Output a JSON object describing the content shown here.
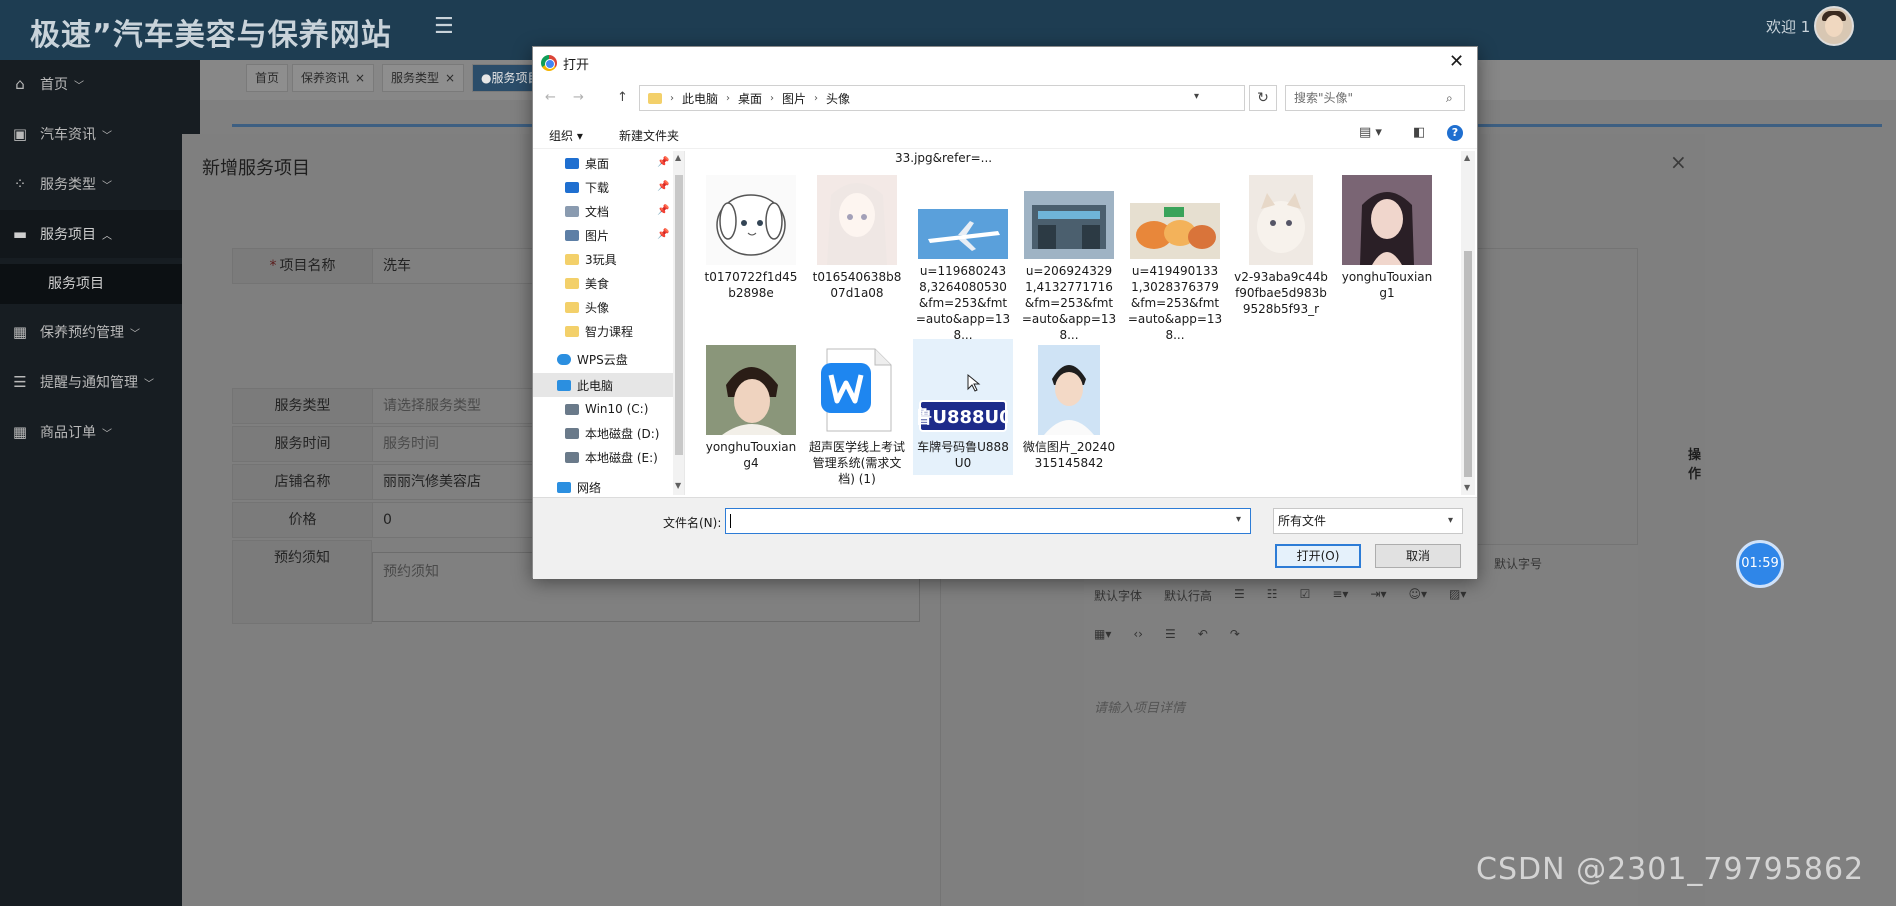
{
  "header": {
    "site_title": "极速”汽车美容与保养网站",
    "welcome": "欢迎 1"
  },
  "sidebar": {
    "items": [
      {
        "label": "首页",
        "icon": "home-icon"
      },
      {
        "label": "汽车资讯",
        "icon": "news-icon"
      },
      {
        "label": "服务类型",
        "icon": "grid-icon"
      },
      {
        "label": "服务项目",
        "icon": "folder-icon"
      },
      {
        "label": "保养预约管理",
        "icon": "table-icon"
      },
      {
        "label": "提醒与通知管理",
        "icon": "server-icon"
      },
      {
        "label": "商品订单",
        "icon": "table-icon"
      }
    ],
    "sub_item": "服务项目"
  },
  "tabs": [
    {
      "label": "首页"
    },
    {
      "label": "保养资讯"
    },
    {
      "label": "服务类型"
    },
    {
      "label": "●服务项目"
    }
  ],
  "modal": {
    "title": "新增服务项目",
    "close": "×",
    "fields": {
      "name_label": "项目名称",
      "name_required": "*",
      "name_value": "洗车",
      "type_label": "服务类型",
      "type_placeholder": "请选择服务类型",
      "time_label": "服务时间",
      "time_placeholder": "服务时间",
      "shop_label": "店铺名称",
      "shop_value": "丽丽汽修美容店",
      "price_label": "价格",
      "price_value": "0",
      "notice_label": "预约须知",
      "notice_placeholder": "预约须知"
    },
    "editor": {
      "font_size": "默认字号",
      "font_family": "默认字体",
      "line_height": "默认行高",
      "placeholder": "请输入项目详情"
    },
    "cut_label": "操作"
  },
  "timer": "01:59",
  "watermark": "CSDN @2301_79795862",
  "dialog": {
    "title": "打开",
    "breadcrumb": [
      "此电脑",
      "桌面",
      "图片",
      "头像"
    ],
    "search_placeholder": "搜索\"头像\"",
    "toolbar": {
      "organize": "组织 ▾",
      "new_folder": "新建文件夹"
    },
    "tree": [
      {
        "label": "桌面",
        "color": "#1f6fd0",
        "pinned": true
      },
      {
        "label": "下载",
        "color": "#1f6fd0",
        "pinned": true
      },
      {
        "label": "文档",
        "color": "#8a9bb0",
        "pinned": true
      },
      {
        "label": "图片",
        "color": "#5d7fa6",
        "pinned": true
      },
      {
        "label": "3玩具",
        "color": "#f3d06a",
        "pinned": false
      },
      {
        "label": "美食",
        "color": "#f3d06a",
        "pinned": false
      },
      {
        "label": "头像",
        "color": "#f3d06a",
        "pinned": false
      },
      {
        "label": "智力课程",
        "color": "#f3d06a",
        "pinned": false
      },
      {
        "label": "WPS云盘",
        "color": "#2b8fe0",
        "pinned": false
      },
      {
        "label": "此电脑",
        "color": "#2b8fe0",
        "pinned": false
      },
      {
        "label": "Win10 (C:)",
        "color": "#6a7a8a",
        "pinned": false
      },
      {
        "label": "本地磁盘 (D:)",
        "color": "#6a7a8a",
        "pinned": false
      },
      {
        "label": "本地磁盘 (E:)",
        "color": "#6a7a8a",
        "pinned": false
      },
      {
        "label": "网络",
        "color": "#2b8fe0",
        "pinned": false
      }
    ],
    "top_cut": "33.jpg&refer=...",
    "files": [
      {
        "name": "t0170722f1d45b2898e"
      },
      {
        "name": "t016540638b807d1a08"
      },
      {
        "name": "u=1196802438,3264080530&fm=253&fmt=auto&app=138..."
      },
      {
        "name": "u=2069243291,4132771716&fm=253&fmt=auto&app=138..."
      },
      {
        "name": "u=4194901331,3028376379&fm=253&fmt=auto&app=138..."
      },
      {
        "name": "v2-93aba9c44bf90fbae5d983b9528b5f93_r"
      },
      {
        "name": "yonghuTouxiang1"
      },
      {
        "name": "yonghuTouxiang4"
      },
      {
        "name": "超声医学线上考试管理系统(需求文档) (1)"
      },
      {
        "name": "车牌号码鲁U888U0"
      },
      {
        "name": "微信图片_20240315145842"
      }
    ],
    "plate_text": "鲁U888U0",
    "filename_label": "文件名(N):",
    "filename_value": "",
    "type_filter": "所有文件",
    "open_button": "打开(O)",
    "cancel_button": "取消"
  }
}
